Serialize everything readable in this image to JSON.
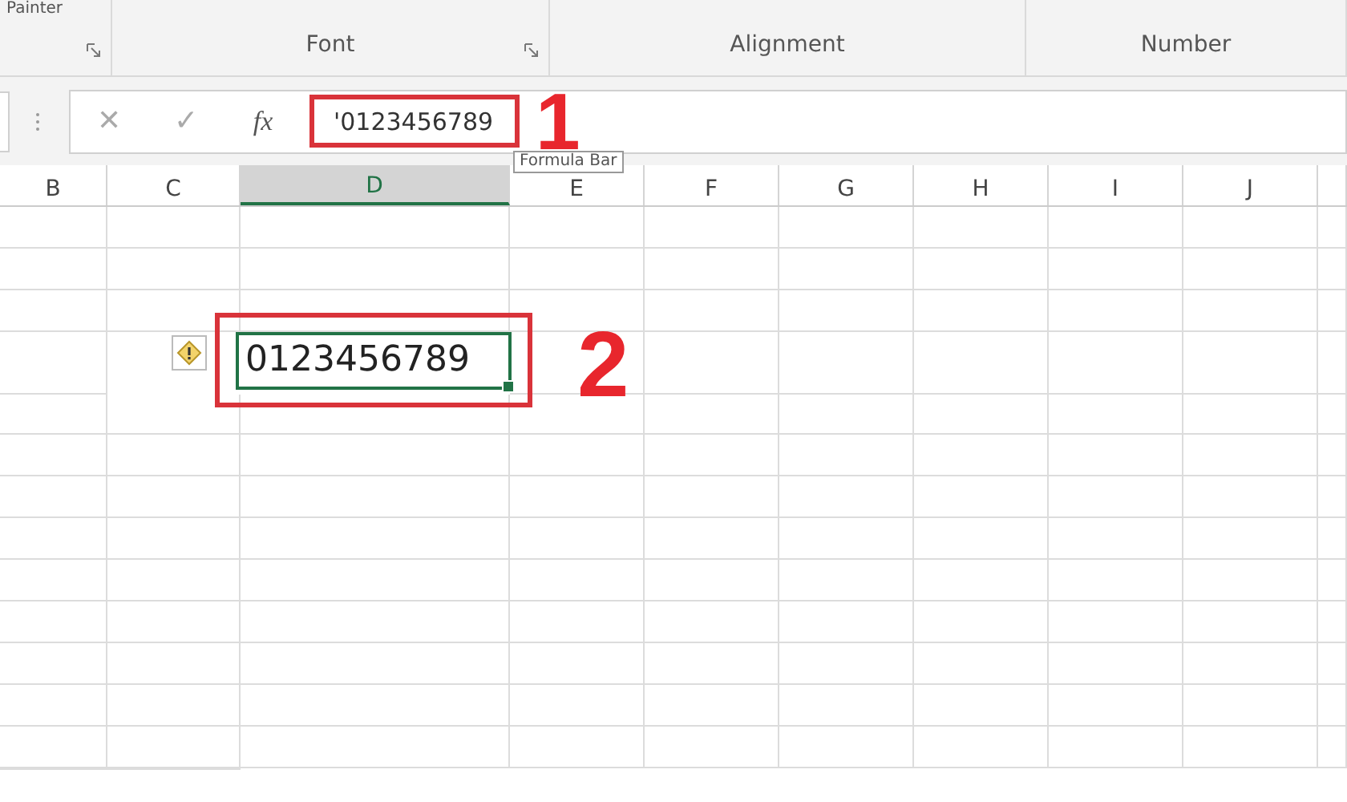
{
  "ribbon": {
    "groups": [
      {
        "label": "Painter",
        "launcher": true
      },
      {
        "label": "Font",
        "launcher": true
      },
      {
        "label": "Alignment",
        "launcher": false
      },
      {
        "label": "Number",
        "launcher": false
      }
    ]
  },
  "formula_bar": {
    "cancel": "✕",
    "enter": "✓",
    "function": "fx",
    "value": "'0123456789",
    "tooltip": "Formula Bar"
  },
  "columns": [
    {
      "label": "B",
      "selected": false
    },
    {
      "label": "C",
      "selected": false
    },
    {
      "label": "D",
      "selected": true
    },
    {
      "label": "E",
      "selected": false
    },
    {
      "label": "F",
      "selected": false
    },
    {
      "label": "G",
      "selected": false
    },
    {
      "label": "H",
      "selected": false
    },
    {
      "label": "I",
      "selected": false
    },
    {
      "label": "J",
      "selected": false
    }
  ],
  "active_cell": {
    "value": "0123456789",
    "warning": true
  },
  "annotations": [
    {
      "label": "1"
    },
    {
      "label": "2"
    }
  ]
}
